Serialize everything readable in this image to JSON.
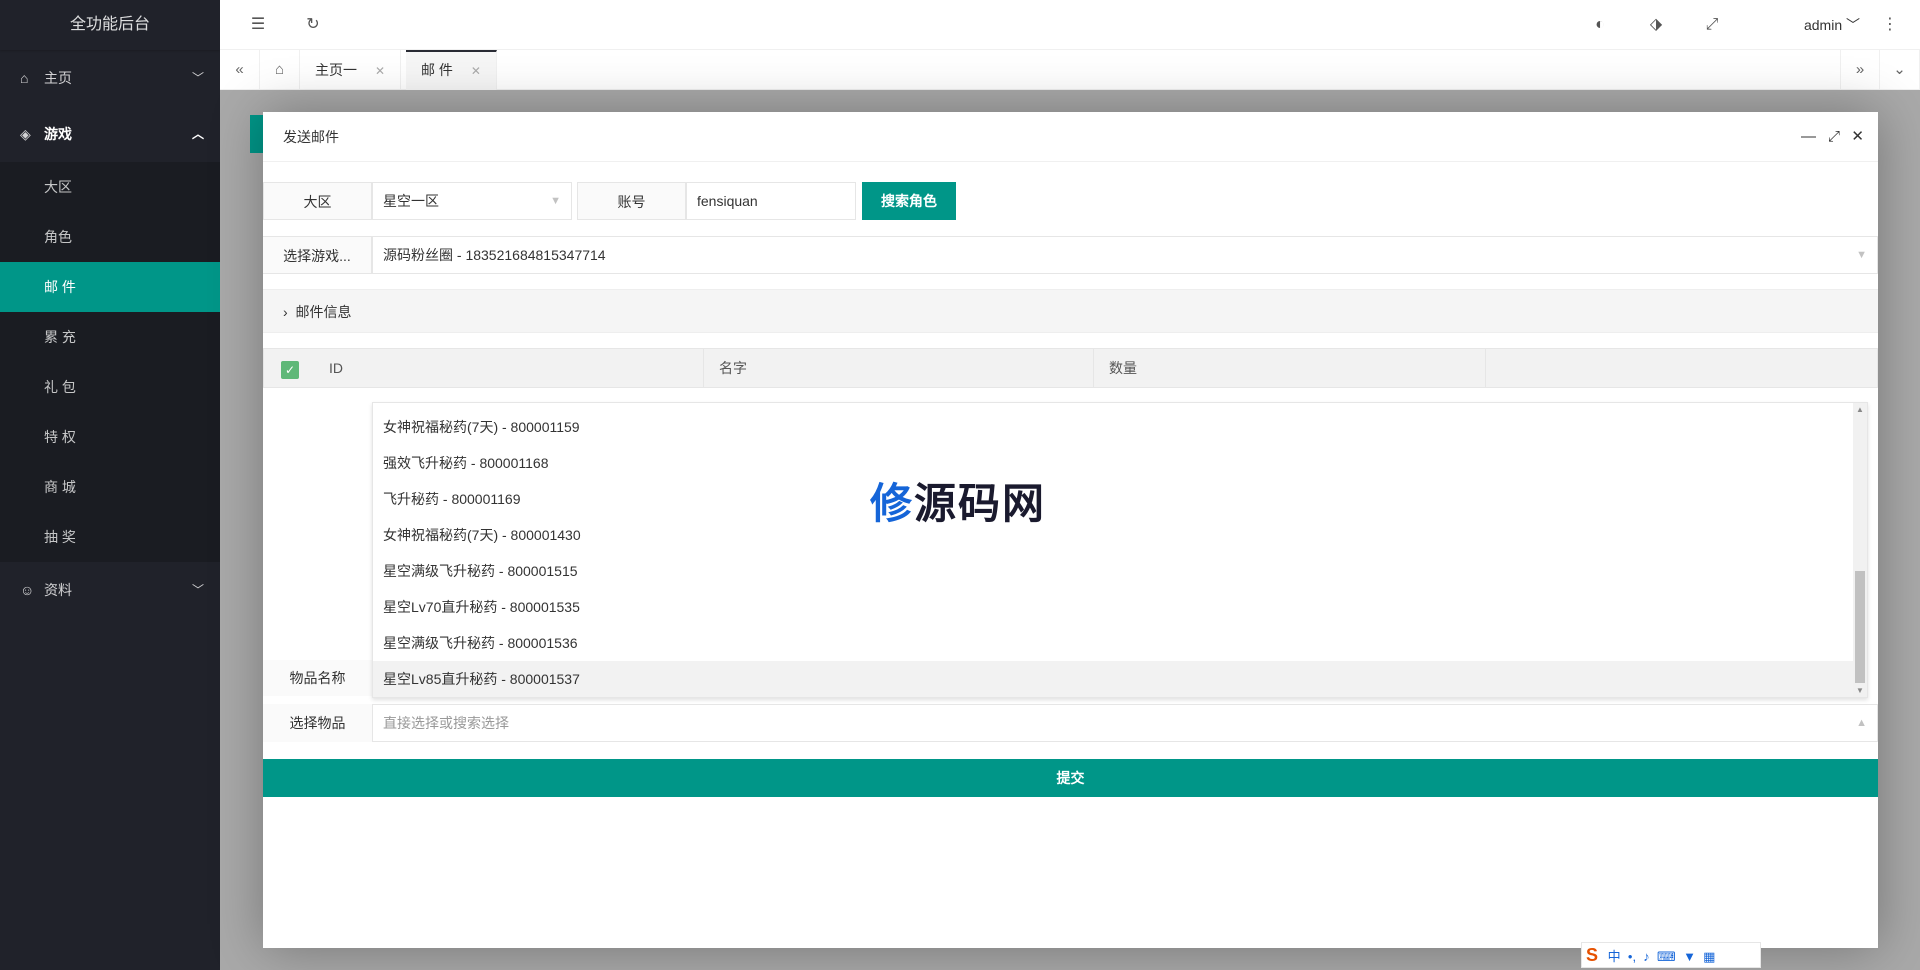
{
  "app": {
    "title": "全功能后台"
  },
  "sidebar": {
    "items": [
      {
        "label": "主页",
        "icon": "home-icon",
        "chevron": "﹀"
      },
      {
        "label": "游戏",
        "icon": "diamond-icon",
        "chevron": "︿"
      },
      {
        "label": "资料",
        "icon": "user-icon",
        "chevron": "﹀"
      }
    ],
    "sub": [
      "大区",
      "角色",
      "邮 件",
      "累 充",
      "礼 包",
      "特 权",
      "商 城",
      "抽 奖"
    ]
  },
  "header": {
    "user": "admin"
  },
  "tabs": [
    {
      "label": "主页一"
    },
    {
      "label": "邮 件"
    }
  ],
  "modal": {
    "title": "发送邮件",
    "region_label": "大区",
    "region_value": "星空一区",
    "account_label": "账号",
    "account_value": "fensiquan",
    "search_button": "搜索角色",
    "role_label": "选择游戏...",
    "role_value": "源码粉丝圈 - 183521684815347714",
    "collapse_label": "邮件信息",
    "table_headers": [
      "ID",
      "名字",
      "数量"
    ],
    "item_name_label": "物品名称",
    "select_item_label": "选择物品",
    "select_item_placeholder": "直接选择或搜索选择",
    "submit": "提交",
    "options": [
      "女神祝福秘药(7天) - 800001159",
      "强效飞升秘药 - 800001168",
      "飞升秘药 - 800001169",
      "女神祝福秘药(7天) - 800001430",
      "星空满级飞升秘药 - 800001515",
      "星空Lv70直升秘药 - 800001535",
      "星空满级飞升秘药 - 800001536",
      "星空Lv85直升秘药 - 800001537"
    ]
  },
  "watermark": {
    "a": "修",
    "b": "源码网"
  },
  "ime": {
    "lang": "中"
  }
}
